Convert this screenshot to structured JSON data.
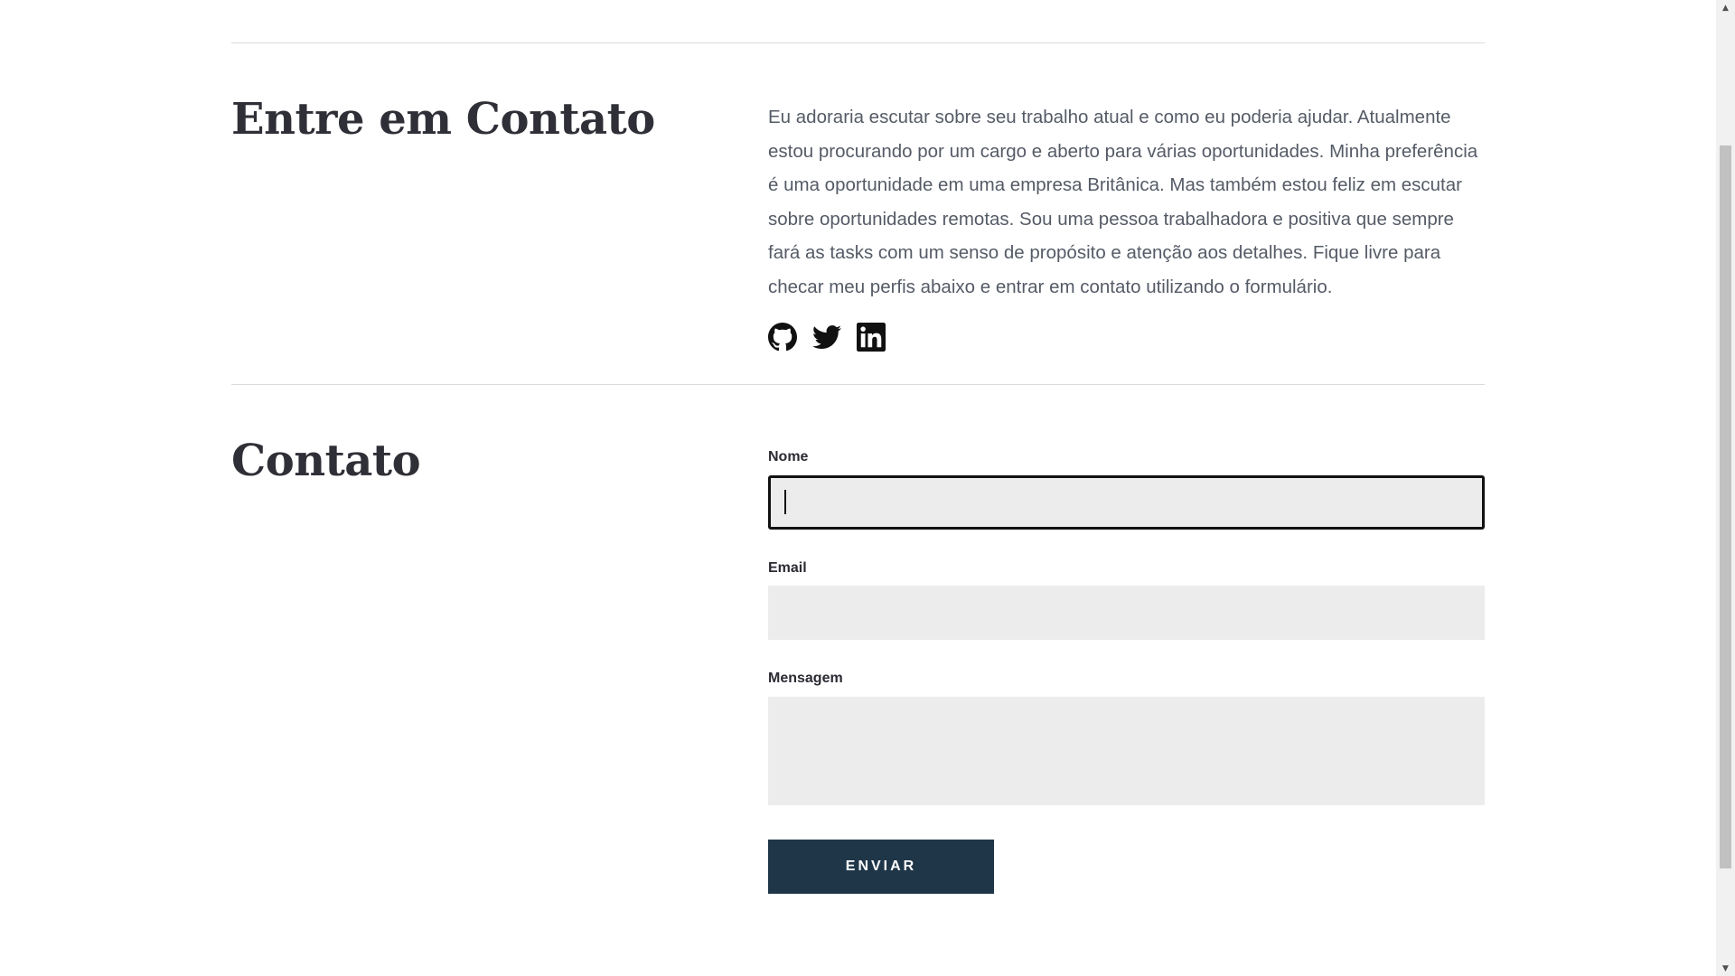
{
  "about": {
    "heading": "Entre em Contato",
    "description": "Eu adoraria escutar sobre seu trabalho atual e como eu poderia ajudar. Atualmente estou procurando por um cargo e aberto para várias oportunidades. Minha preferência é uma oportunidade em uma empresa Britânica. Mas também estou feliz em escutar sobre oportunidades remotas. Sou uma pessoa trabalhadora e positiva que sempre fará as tasks com um senso de propósito e atenção aos detalhes. Fique livre para checar meu perfis abaixo e entrar em contato utilizando o formulário.",
    "socials": [
      {
        "icon": "github-icon"
      },
      {
        "icon": "twitter-icon"
      },
      {
        "icon": "linkedin-icon"
      }
    ]
  },
  "contact": {
    "heading": "Contato",
    "fields": {
      "name": {
        "label": "Nome",
        "value": ""
      },
      "email": {
        "label": "Email",
        "value": ""
      },
      "message": {
        "label": "Mensagem",
        "value": ""
      }
    },
    "submit_label": "ENVIAR"
  },
  "scrollbar": {
    "up_arrow": "▲",
    "down_arrow": "▼"
  },
  "colors": {
    "accent_button": "#1f3649",
    "input_background": "#ececec",
    "heading": "#2f2f37",
    "body_text": "#555b66"
  }
}
